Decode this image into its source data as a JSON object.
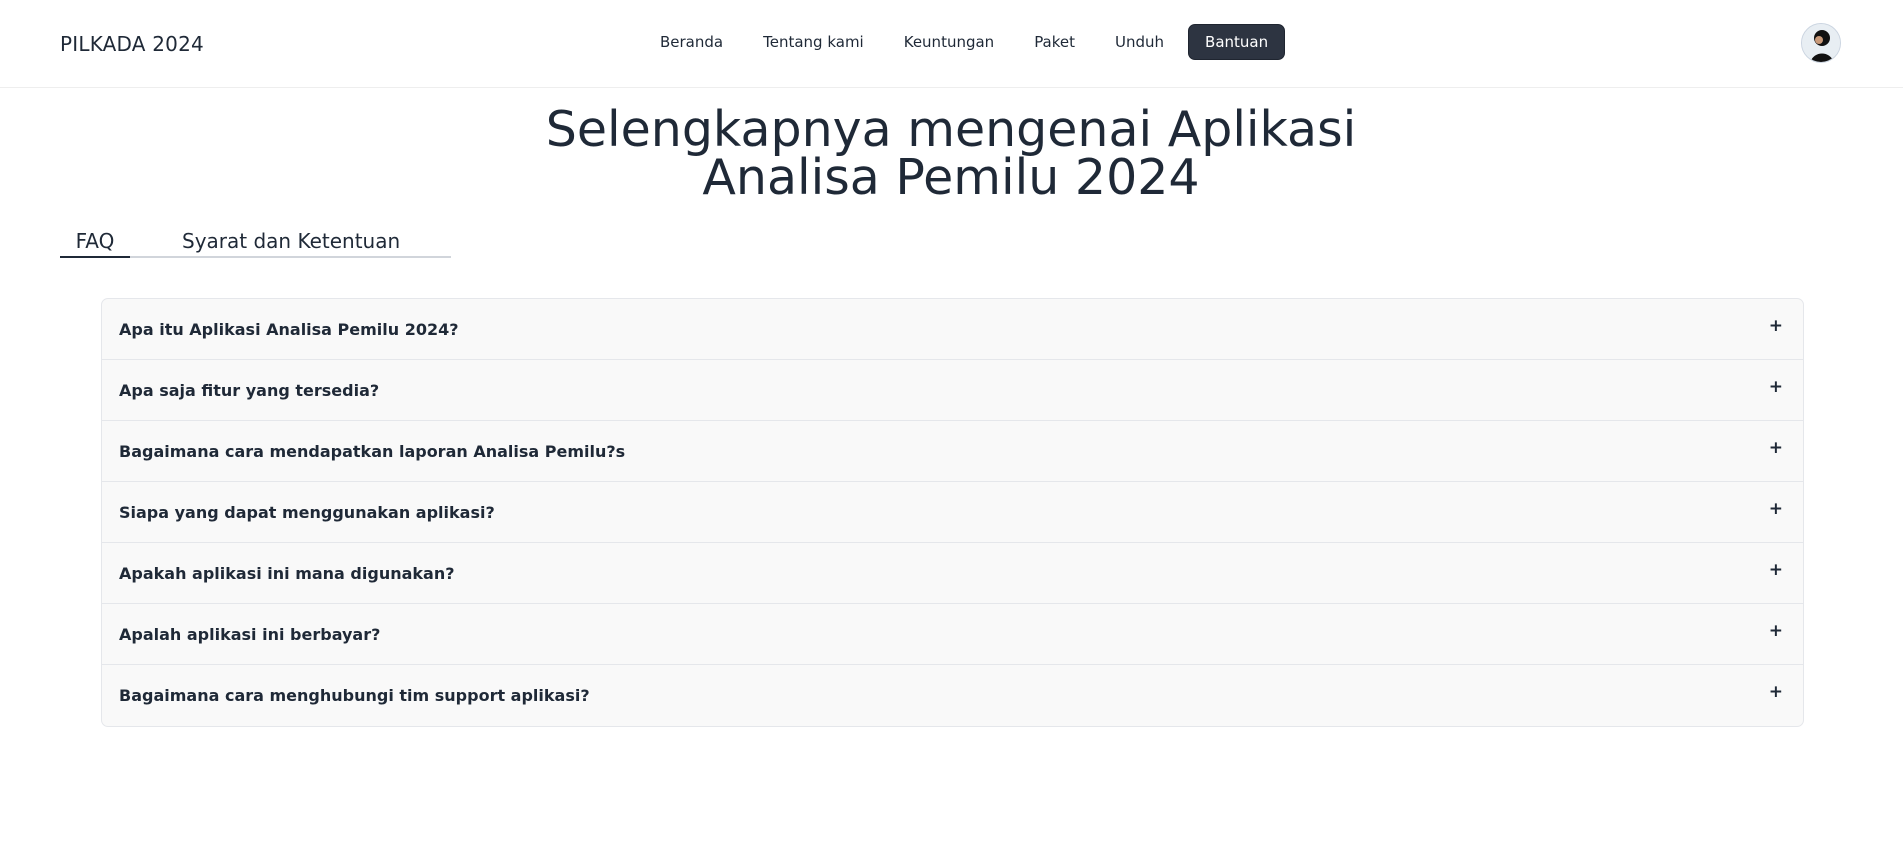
{
  "header": {
    "brand": "PILKADA 2024",
    "nav": [
      {
        "label": "Beranda",
        "active": false
      },
      {
        "label": "Tentang kami",
        "active": false
      },
      {
        "label": "Keuntungan",
        "active": false
      },
      {
        "label": "Paket",
        "active": false
      },
      {
        "label": "Unduh",
        "active": false
      },
      {
        "label": "Bantuan",
        "active": true
      }
    ]
  },
  "hero": {
    "title_line1": "Selengkapnya mengenai Aplikasi",
    "title_line2": "Analisa Pemilu 2024"
  },
  "tabs": [
    {
      "label": "FAQ",
      "active": true
    },
    {
      "label": "Syarat dan Ketentuan",
      "active": false
    }
  ],
  "faq": {
    "toggle_symbol": "+",
    "items": [
      {
        "question": "Apa itu Aplikasi Analisa Pemilu 2024?"
      },
      {
        "question": "Apa saja fitur yang tersedia?"
      },
      {
        "question": "Bagaimana cara mendapatkan laporan Analisa Pemilu?s"
      },
      {
        "question": "Siapa yang dapat menggunakan aplikasi?"
      },
      {
        "question": "Apakah aplikasi ini mana digunakan?"
      },
      {
        "question": "Apalah aplikasi ini berbayar?"
      },
      {
        "question": "Bagaimana cara menghubungi tim support aplikasi?"
      }
    ]
  },
  "colors": {
    "text": "#1f2937",
    "active_nav_bg": "#2d3441",
    "accordion_bg": "#f9f9f9",
    "border": "#e5e7eb"
  }
}
